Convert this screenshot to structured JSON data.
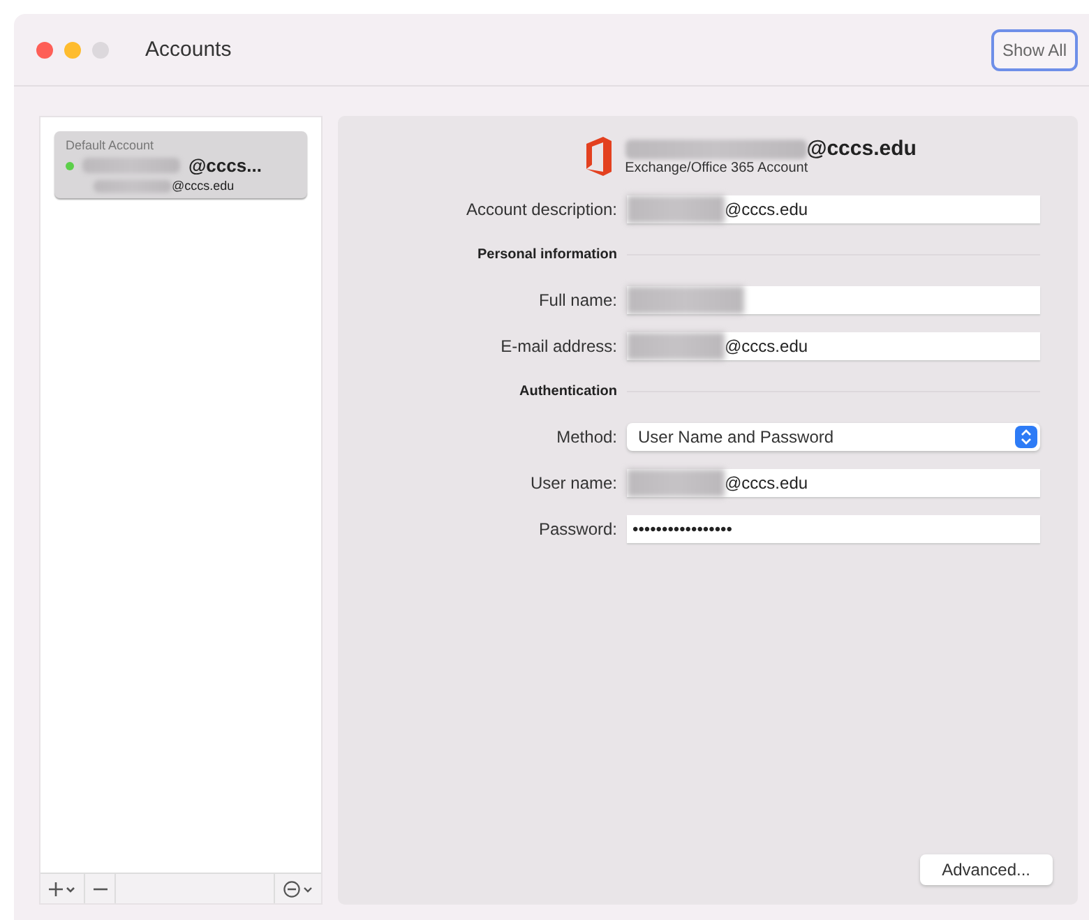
{
  "window": {
    "title": "Accounts",
    "show_all_button": "Show All",
    "traffic_lights": [
      {
        "color": "#fe5f57"
      },
      {
        "color": "#febc2e"
      },
      {
        "color": "#dcd8dc"
      }
    ]
  },
  "sidebar": {
    "accounts": [
      {
        "header": "Default Account",
        "name": "@cccs...",
        "email": "@cccs.edu",
        "redacted": true,
        "online": true,
        "selected": true
      }
    ]
  },
  "detail": {
    "account_name": "@cccs.edu",
    "account_type": "Exchange/Office 365 Account",
    "rows": [
      {
        "kind": "field",
        "label": "Account description:",
        "value": "@cccs.edu",
        "redacted": true
      },
      {
        "kind": "section",
        "label": "Personal information"
      },
      {
        "kind": "field",
        "label": "Full name:",
        "redacted": true
      },
      {
        "kind": "field",
        "label": "E-mail address:",
        "value": "@cccs.edu",
        "redacted": true
      },
      {
        "kind": "section",
        "label": "Authentication"
      },
      {
        "kind": "select",
        "label": "Method:",
        "value": "User Name and Password"
      },
      {
        "kind": "field",
        "label": "User name:",
        "value": "@cccs.edu",
        "redacted": true
      },
      {
        "kind": "password",
        "label": "Password:",
        "value": "•••••••••••••••••"
      }
    ],
    "advanced_button": "Advanced..."
  }
}
